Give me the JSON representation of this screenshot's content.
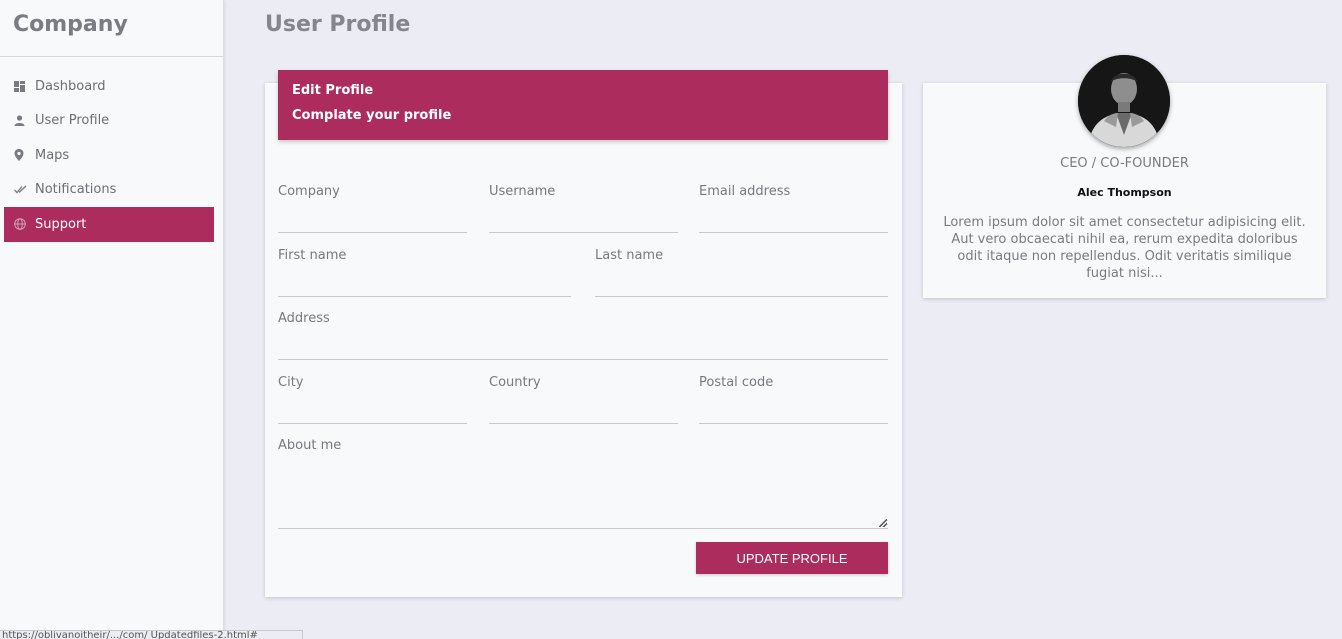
{
  "sidebar": {
    "brand": "Company",
    "items": [
      {
        "label": "Dashboard",
        "icon": "dashboard-icon"
      },
      {
        "label": "User Profile",
        "icon": "person-icon"
      },
      {
        "label": "Maps",
        "icon": "map-pin-icon"
      },
      {
        "label": "Notifications",
        "icon": "double-check-icon"
      },
      {
        "label": "Support",
        "icon": "globe-icon",
        "active": true
      }
    ]
  },
  "page": {
    "title": "User Profile"
  },
  "form": {
    "header_title": "Edit Profile",
    "header_subtitle": "Complate your profile",
    "fields": {
      "company": {
        "label": "Company",
        "value": ""
      },
      "username": {
        "label": "Username",
        "value": ""
      },
      "email": {
        "label": "Email address",
        "value": ""
      },
      "first_name": {
        "label": "First name",
        "value": ""
      },
      "last_name": {
        "label": "Last name",
        "value": ""
      },
      "address": {
        "label": "Address",
        "value": ""
      },
      "city": {
        "label": "City",
        "value": ""
      },
      "country": {
        "label": "Country",
        "value": ""
      },
      "postal_code": {
        "label": "Postal code",
        "value": ""
      },
      "about": {
        "label": "About me",
        "value": ""
      }
    },
    "submit_label": "UPDATE PROFILE"
  },
  "profile": {
    "role": "CEO / CO-FOUNDER",
    "name": "Alec Thompson",
    "bio": "Lorem ipsum dolor sit amet consectetur adipisicing elit. Aut vero obcaecati nihil ea, rerum expedita doloribus odit itaque non repellendus. Odit veritatis similique fugiat nisi..."
  },
  "status_bar": {
    "url": "https://oblivanoitheir/.../com/ Updatedfiles-2.html#"
  },
  "colors": {
    "accent": "#ab2c5d",
    "background": "#ececf4",
    "card": "#f8f9fb"
  }
}
